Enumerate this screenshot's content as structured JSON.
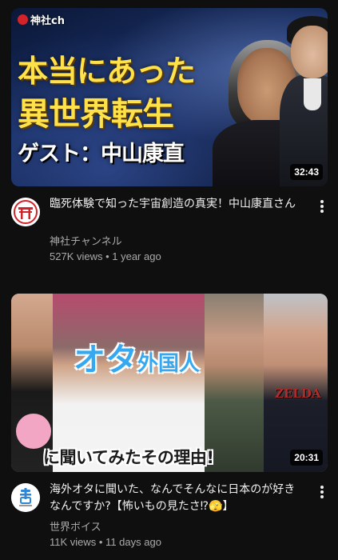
{
  "colors": {
    "background": "#0f0f0f",
    "primary_text": "#f1f1f1",
    "secondary_text": "#aaaaaa",
    "title_yellow": "#ffe14a",
    "title_blue": "#35a8f0",
    "brand_red": "#d2232a"
  },
  "videos": [
    {
      "thumbnail": {
        "brand": "神社ch",
        "line1": "本当にあった",
        "line2": "異世界転生",
        "line3": "ゲスト：中山康直"
      },
      "duration": "32:43",
      "avatar_icon": "shrine-logo-icon",
      "title": "臨死体験で知った宇宙創造の真実！中山康直さん",
      "channel": "神社チャンネル",
      "stats": "527K views • 1 year ago",
      "menu_icon": "more-vert-icon"
    },
    {
      "thumbnail": {
        "top_big": "オタ",
        "top_small": "外国人",
        "bottom": "に聞いてみたその理由!",
        "zelda": "ZELDA"
      },
      "duration": "20:31",
      "avatar_icon": "sekai-voice-logo-icon",
      "title": "海外オタに聞いた、なんでそんなに日本のが好きなんですか?【怖いもの見たさ⁉🫣】",
      "channel": "世界ボイス",
      "stats": "11K views • 11 days ago",
      "menu_icon": "more-vert-icon"
    }
  ]
}
